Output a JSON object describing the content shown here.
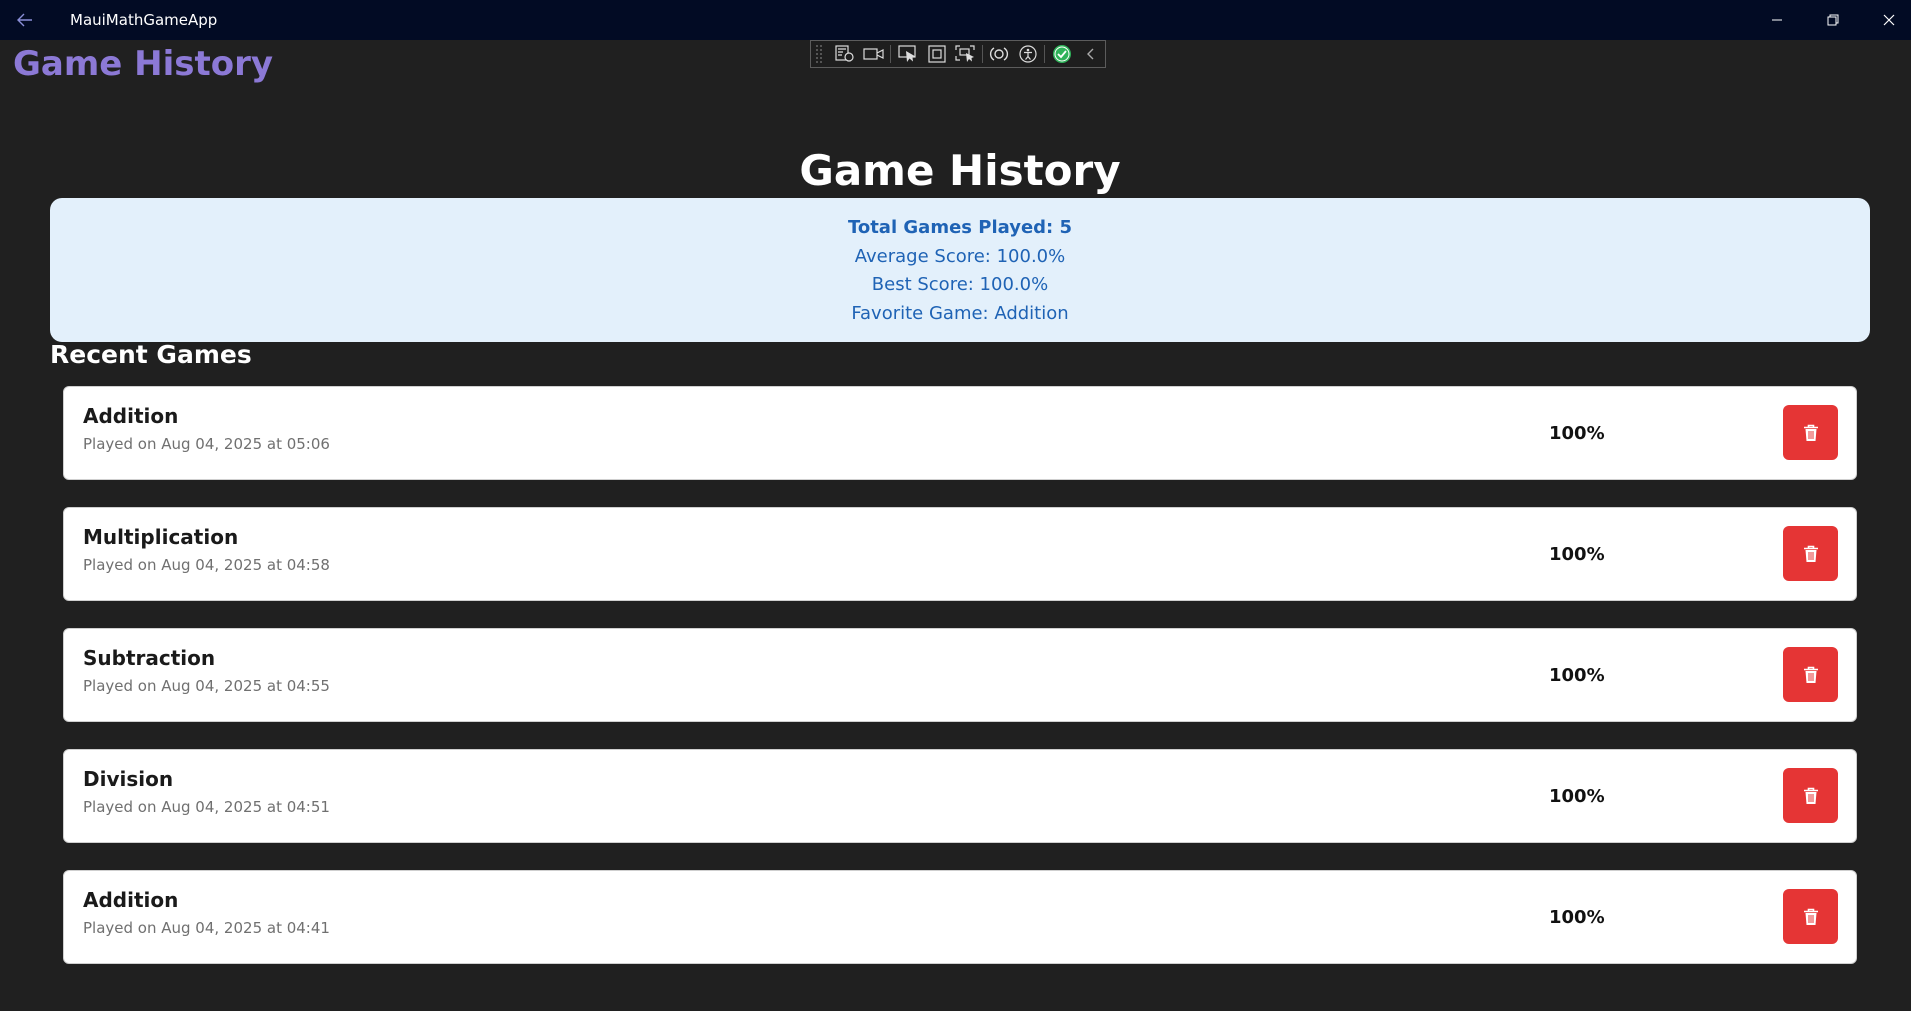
{
  "window": {
    "title": "MauiMathGameApp",
    "back_icon": "arrow-left-icon",
    "controls": [
      "minimize-icon",
      "restore-icon",
      "close-icon"
    ]
  },
  "nav": {
    "title": "Game History"
  },
  "debug_toolbar": {
    "icons": [
      "live-visual-tree-icon",
      "record-icon",
      "select-element-icon",
      "display-layout-adorners-icon",
      "track-focused-element-icon",
      "hot-reload-icon",
      "accessibility-icon",
      "binding-check-icon",
      "collapse-icon"
    ]
  },
  "page": {
    "heading": "Game History",
    "recent_heading": "Recent Games"
  },
  "stats": {
    "total": "Total Games Played: 5",
    "average": "Average Score: 100.0%",
    "best": "Best Score: 100.0%",
    "favorite": "Favorite Game: Addition"
  },
  "games": [
    {
      "name": "Addition",
      "date": "Played on Aug 04, 2025 at 05:06",
      "score": "100%"
    },
    {
      "name": "Multiplication",
      "date": "Played on Aug 04, 2025 at 04:58",
      "score": "100%"
    },
    {
      "name": "Subtraction",
      "date": "Played on Aug 04, 2025 at 04:55",
      "score": "100%"
    },
    {
      "name": "Division",
      "date": "Played on Aug 04, 2025 at 04:51",
      "score": "100%"
    },
    {
      "name": "Addition",
      "date": "Played on Aug 04, 2025 at 04:41",
      "score": "100%"
    }
  ],
  "colors": {
    "titlebar": "#020b24",
    "background": "#202020",
    "nav_title": "#8c79d6",
    "stats_bg": "#e3f0fb",
    "stats_text": "#1f63b5",
    "delete": "#e53535"
  }
}
